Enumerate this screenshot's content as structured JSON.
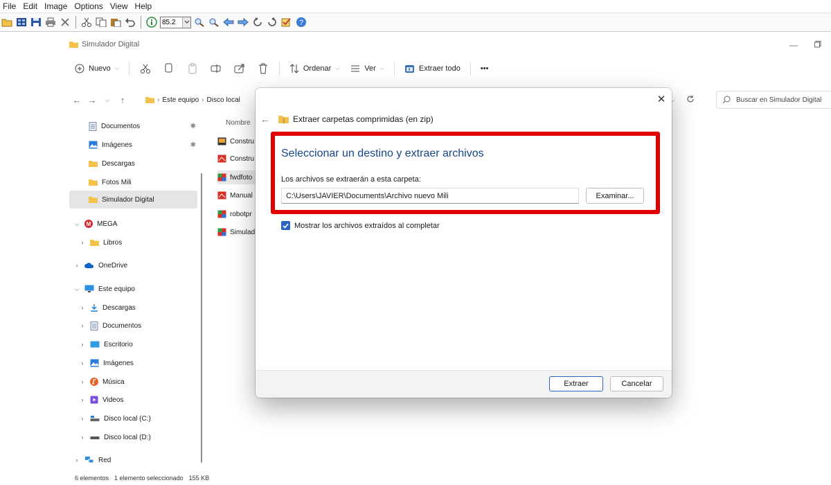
{
  "viewer": {
    "menu": [
      "File",
      "Edit",
      "Image",
      "Options",
      "View",
      "Help"
    ],
    "zoom_value": "85.2"
  },
  "explorer": {
    "window_title": "Simulador Digital",
    "toolbar": {
      "new_label": "Nuevo",
      "sort_label": "Ordenar",
      "view_label": "Ver",
      "extract_all_label": "Extraer todo",
      "more_label": "•••"
    },
    "address": {
      "part1": "Este equipo",
      "part2": "Disco local"
    },
    "search_placeholder": "Buscar en Simulador Digital",
    "nav": {
      "quick_access": [
        {
          "label": "Documentos",
          "icon": "document-icon",
          "pinned": true
        },
        {
          "label": "Imágenes",
          "icon": "pictures-icon",
          "pinned": true
        },
        {
          "label": "Descargas",
          "icon": "folder-icon",
          "pinned": false
        },
        {
          "label": "Fotos Mili",
          "icon": "folder-icon",
          "pinned": false
        },
        {
          "label": "Simulador Digital",
          "icon": "folder-icon",
          "pinned": false,
          "selected": true
        }
      ],
      "mega": "MEGA",
      "libros": "Libros",
      "onedrive": "OneDrive",
      "este_equipo": "Este equipo",
      "pc_items": [
        {
          "label": "Descargas",
          "icon": "download-icon"
        },
        {
          "label": "Documentos",
          "icon": "document-icon"
        },
        {
          "label": "Escritorio",
          "icon": "desktop-icon"
        },
        {
          "label": "Imágenes",
          "icon": "pictures-icon"
        },
        {
          "label": "Música",
          "icon": "music-icon"
        },
        {
          "label": "Videos",
          "icon": "video-icon"
        },
        {
          "label": "Disco local (C:)",
          "icon": "drive-c-icon"
        },
        {
          "label": "Disco local (D:)",
          "icon": "drive-d-icon"
        }
      ],
      "red": "Red"
    },
    "files": {
      "header": "Nombre",
      "items": [
        {
          "label": "Constru",
          "icon": "app-icon"
        },
        {
          "label": "Constru",
          "icon": "pdf-icon"
        },
        {
          "label": "fwdfoto",
          "icon": "archive-icon",
          "selected": true
        },
        {
          "label": "Manual",
          "icon": "pdf-icon"
        },
        {
          "label": "robotpr",
          "icon": "archive-icon"
        },
        {
          "label": "Simulad",
          "icon": "archive-icon"
        }
      ]
    },
    "status": {
      "count": "6 elementos",
      "selected": "1 elemento seleccionado",
      "size": "155 KB"
    }
  },
  "dialog": {
    "heading": "Extraer carpetas comprimidas (en zip)",
    "title": "Seleccionar un destino y extraer archivos",
    "label": "Los archivos se extraerán a esta carpeta:",
    "path_value": "C:\\Users\\JAVIER\\Documents\\Archivo nuevo Mili",
    "browse_label": "Examinar...",
    "checkbox_label": "Mostrar los archivos extraídos al completar",
    "checkbox_checked": true,
    "extract_label": "Extraer",
    "cancel_label": "Cancelar"
  },
  "colors": {
    "accent": "#2a64c2",
    "highlight_frame": "#e00000",
    "dialog_title": "#16458a"
  }
}
